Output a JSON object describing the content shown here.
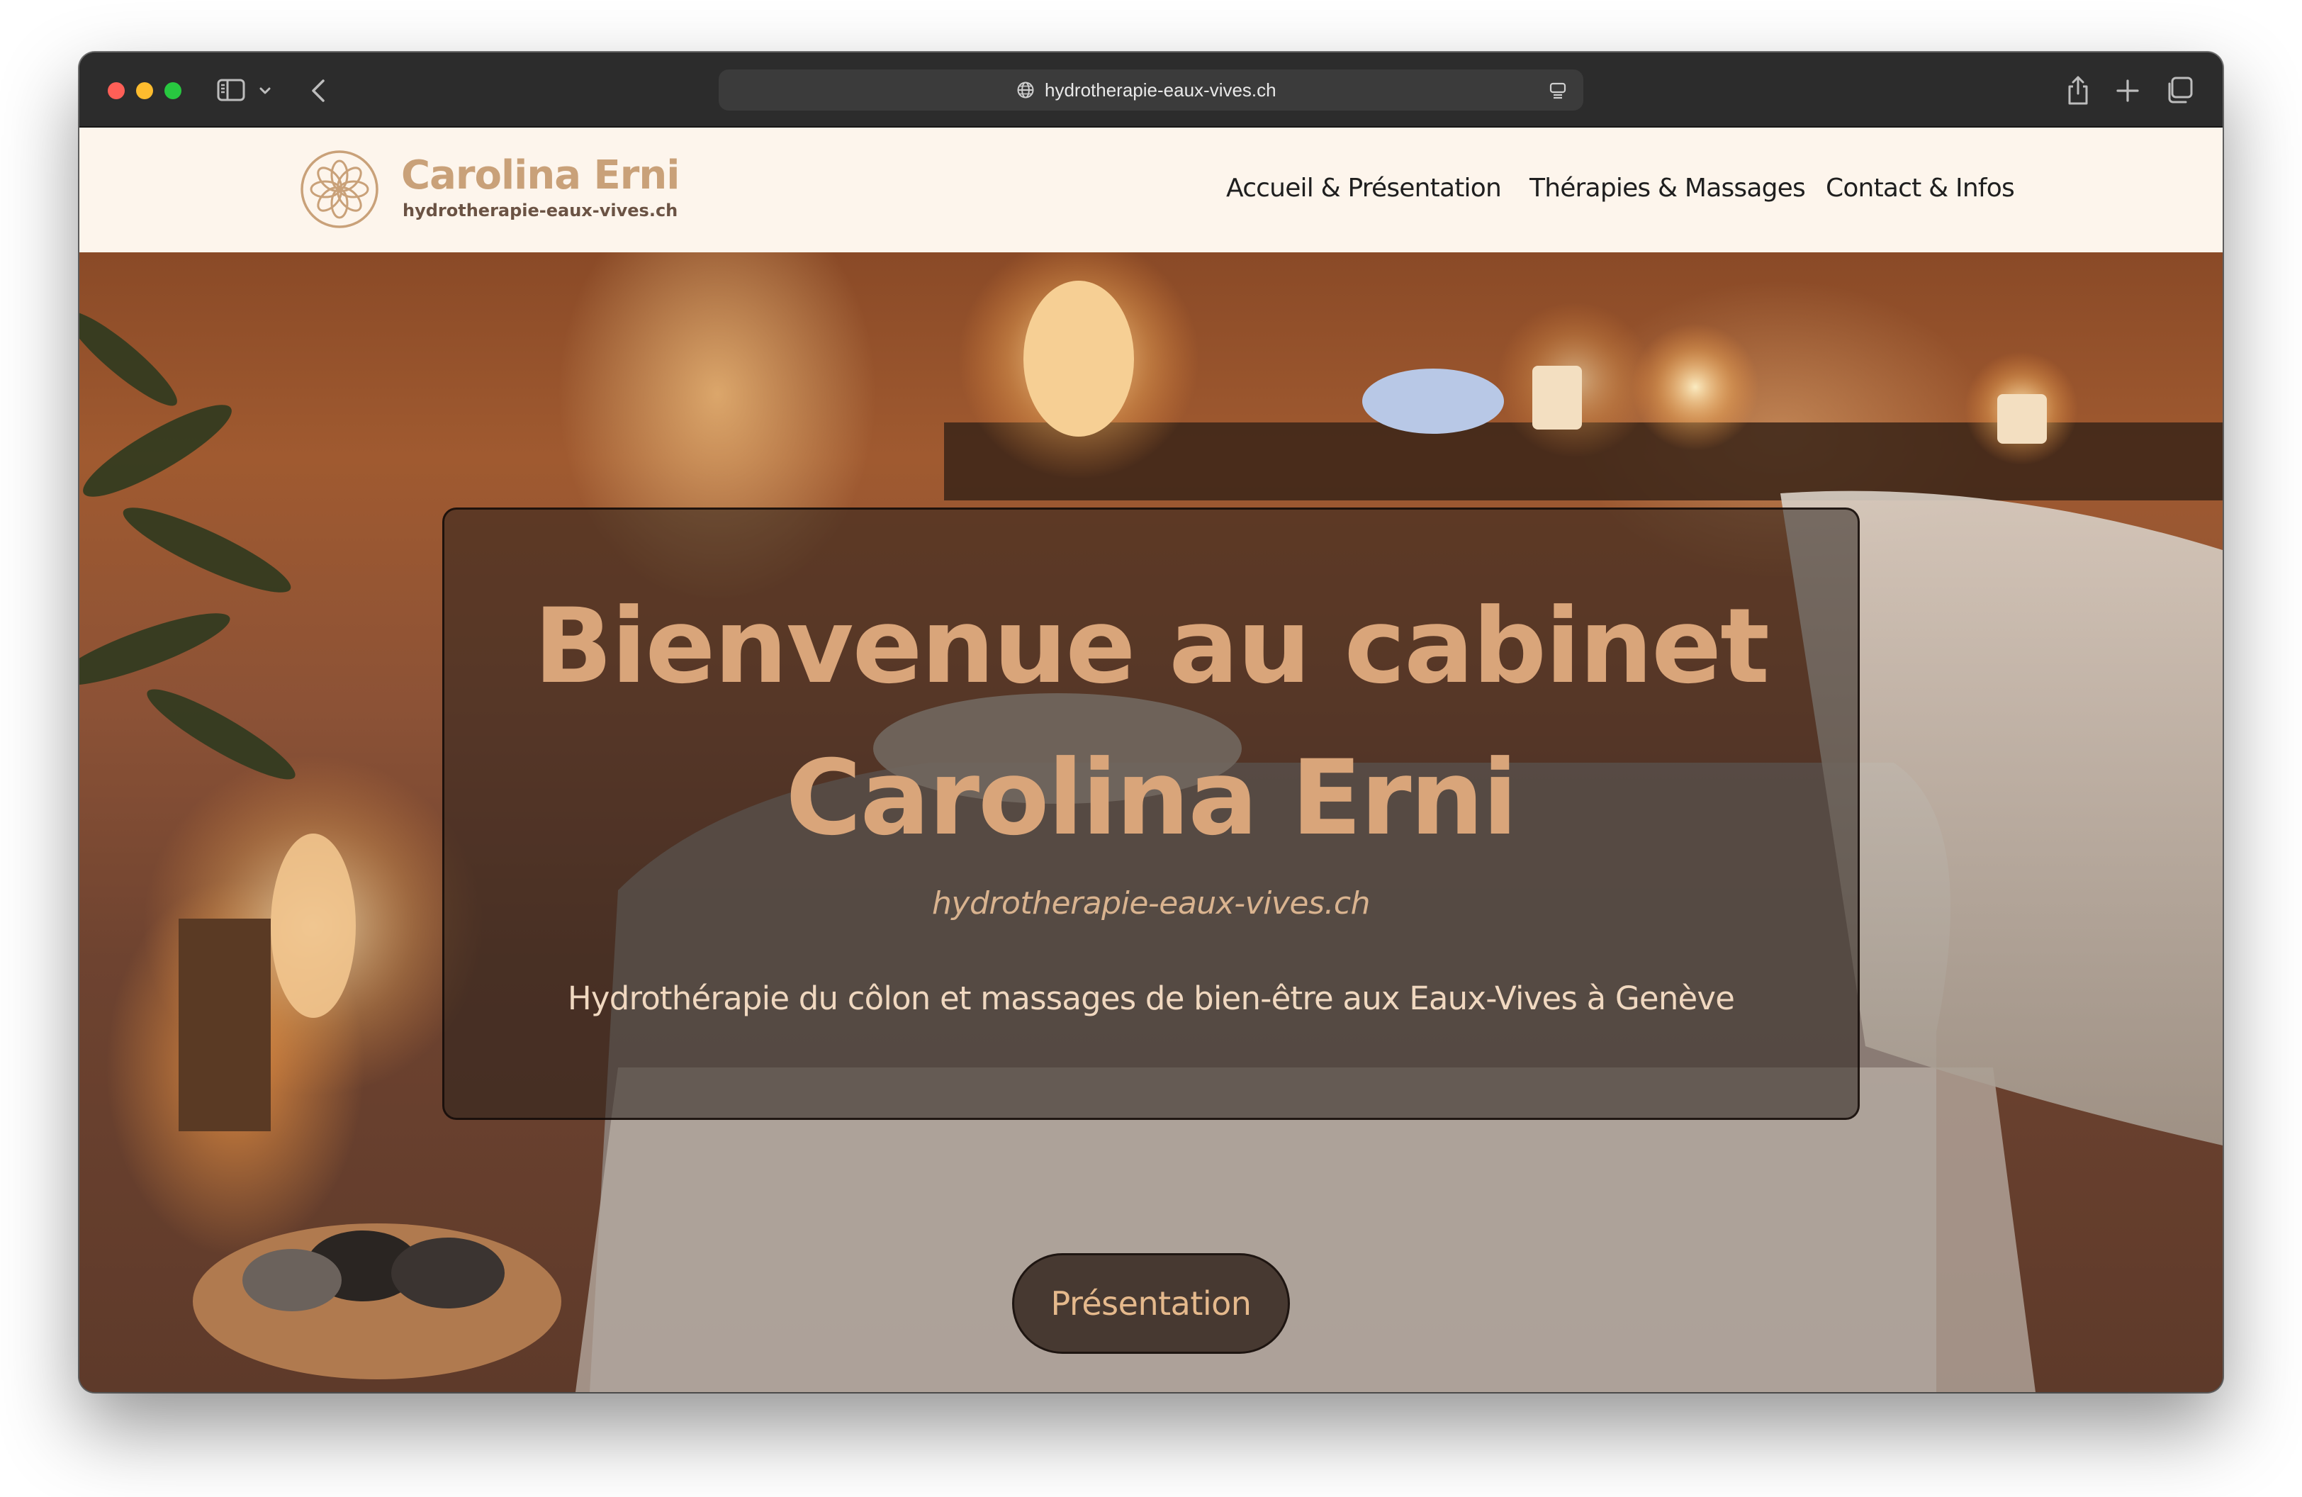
{
  "browser": {
    "url": "hydrotherapie-eaux-vives.ch",
    "icons": [
      "sidebar-toggle-icon",
      "chevron-down-icon",
      "back-icon",
      "globe-icon",
      "reader-mode-icon",
      "share-icon",
      "new-tab-plus-icon",
      "tab-overview-icon"
    ],
    "traffic_lights": {
      "close": "#ff5f57",
      "minimize": "#febc2e",
      "zoom": "#28c840"
    }
  },
  "site": {
    "brand_name": "Carolina Erni",
    "brand_domain": "hydrotherapie-eaux-vives.ch",
    "nav": [
      {
        "label": "Accueil & Présentation"
      },
      {
        "label": "Thérapies & Massages"
      },
      {
        "label": "Contact & Infos"
      }
    ],
    "colors": {
      "header_bg": "#fdf5ec",
      "brand": "#c9a179",
      "title": "#d9a57a"
    }
  },
  "hero": {
    "title_line1": "Bienvenue au cabinet",
    "title_line2": "Carolina Erni",
    "subtitle": "hydrotherapie-eaux-vives.ch",
    "tagline": "Hydrothérapie du côlon et massages de bien-être aux Eaux-Vives à Genève",
    "cta_label": "Présentation"
  }
}
